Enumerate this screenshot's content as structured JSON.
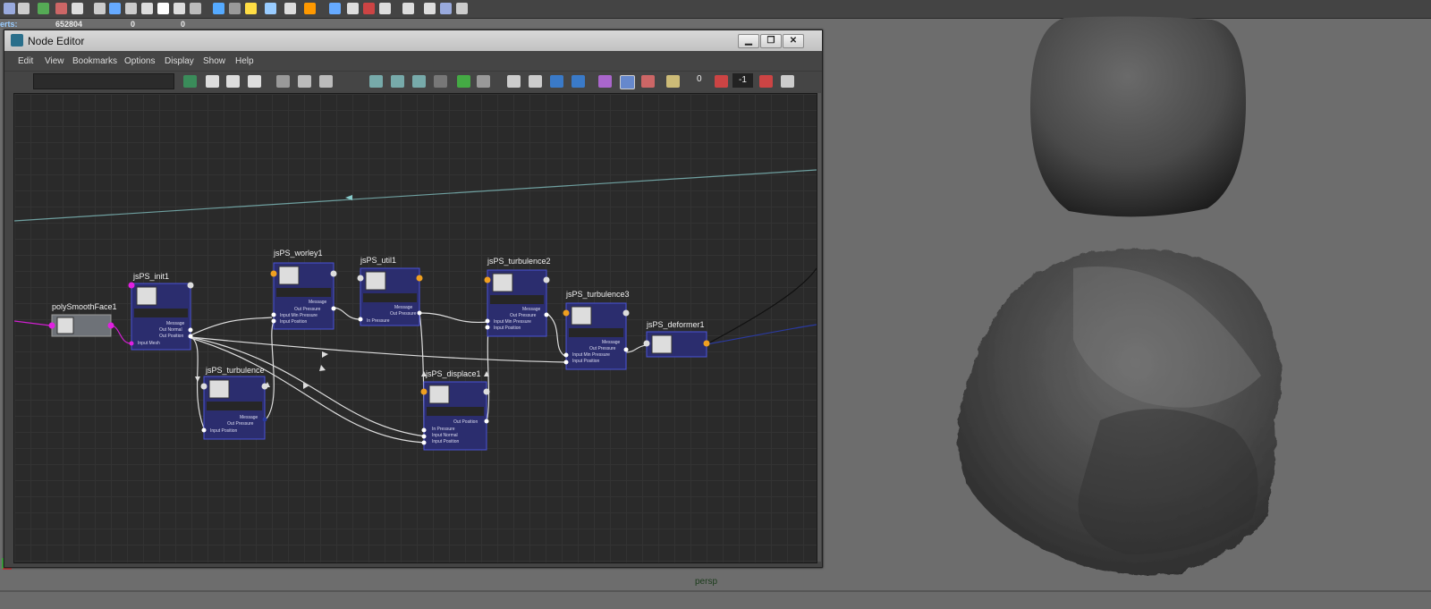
{
  "hud": {
    "label": "erts:",
    "values": [
      "652804",
      "0",
      "0"
    ]
  },
  "viewport": {
    "camera": "persp"
  },
  "node_editor": {
    "title": "Node Editor",
    "window_buttons": [
      "▁",
      "❐",
      "✕"
    ],
    "menu": [
      "Edit",
      "View",
      "Bookmarks",
      "Options",
      "Display",
      "Show",
      "Help"
    ],
    "toolbar": {
      "zero_value": "0",
      "field_value": "-1"
    }
  },
  "nodes": {
    "polySmoothFace1": {
      "title": "polySmoothFace1"
    },
    "jsPS_init1": {
      "title": "jsPS_init1",
      "attrs": [
        "Message",
        "Out Normal",
        "Out Position",
        "Input Mesh"
      ]
    },
    "jsPS_worley1": {
      "title": "jsPS_worley1",
      "attrs": [
        "Message",
        "Out Pressure",
        "Input Min Pressure",
        "Input Position"
      ]
    },
    "jsPS_util1": {
      "title": "jsPS_util1",
      "attrs": [
        "Message",
        "Out Pressure",
        "In Pressure"
      ]
    },
    "jsPS_turbulence2": {
      "title": "jsPS_turbulence2",
      "attrs": [
        "Message",
        "Out Pressure",
        "Input Min Pressure",
        "Input Position"
      ]
    },
    "jsPS_turbulence3": {
      "title": "jsPS_turbulence3",
      "attrs": [
        "Message",
        "Out Pressure",
        "Input Min Pressure",
        "Input Position"
      ]
    },
    "jsPS_turbulence1": {
      "title": "jsPS_turbulence",
      "attrs": [
        "Message",
        "Out Pressure",
        "Input Position"
      ]
    },
    "jsPS_displace1": {
      "title": "jsPS_displace1",
      "attrs": [
        "Out Position",
        "In Pressure",
        "Input Normal",
        "Input Position"
      ]
    },
    "jsPS_deformer1": {
      "title": "jsPS_deformer1"
    }
  }
}
